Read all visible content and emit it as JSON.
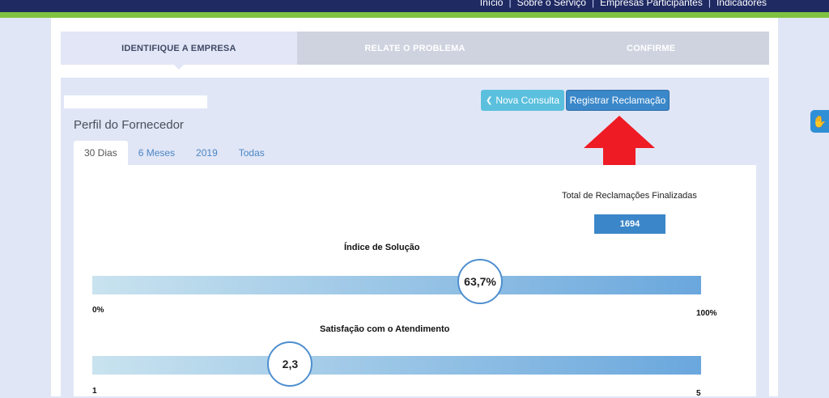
{
  "top_nav": {
    "items": [
      "Início",
      "Sobre o Serviço",
      "Empresas Participantes",
      "Indicadores"
    ],
    "separator": "|"
  },
  "steps": [
    {
      "label": "IDENTIFIQUE A EMPRESA",
      "active": true
    },
    {
      "label": "RELATE O PROBLEMA",
      "active": false
    },
    {
      "label": "CONFIRME",
      "active": false
    }
  ],
  "actions": {
    "nova_consulta_icon": "chevron-left-icon",
    "nova_consulta_label": "Nova Consulta",
    "registrar_label": "Registrar Reclamação"
  },
  "profile": {
    "title": "Perfil do Fornecedor",
    "tabs": [
      "30 Dias",
      "6 Meses",
      "2019",
      "Todas"
    ],
    "active_tab": "30 Dias"
  },
  "stats": {
    "total_label": "Total de Reclamações Finalizadas",
    "total_value": "1694",
    "solucao": {
      "title": "Índice de Solução",
      "value_label": "63,7%",
      "value": 63.7,
      "min_label": "0%",
      "max_label": "100%",
      "min": 0,
      "max": 100
    },
    "satisfacao": {
      "title": "Satisfação com o Atendimento",
      "value_label": "2,3",
      "value": 2.3,
      "min_label": "1",
      "max_label": "5",
      "min": 1,
      "max": 5
    }
  },
  "colors": {
    "topbar": "#1f2a63",
    "green_stripe": "#7fc241",
    "accent_blue": "#3a87c9",
    "info_blue": "#5bc0de",
    "annotation_arrow": "#ee1b24"
  },
  "accessibility_widget_icon": "sign-language-hands-icon"
}
